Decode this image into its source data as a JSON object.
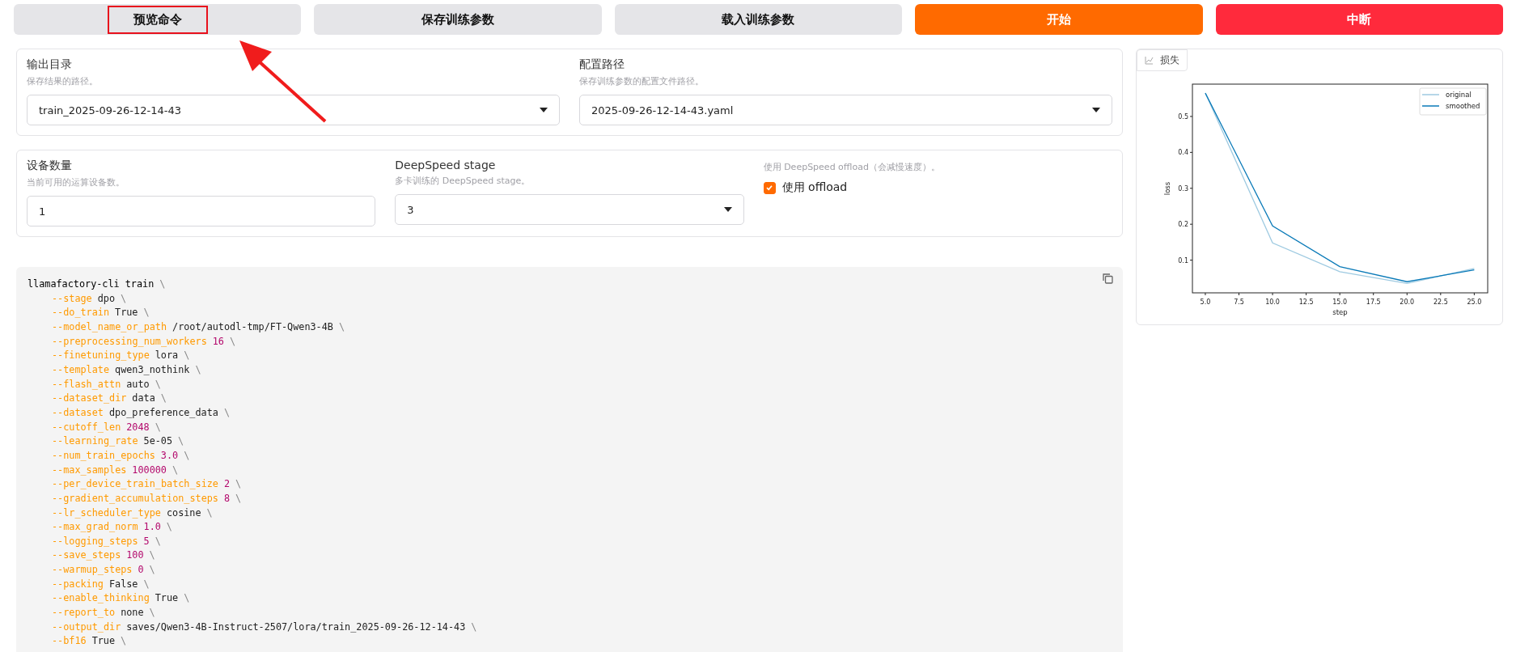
{
  "buttons": [
    {
      "label": "预览命令",
      "kind": "neutral",
      "highlighted": true
    },
    {
      "label": "保存训练参数",
      "kind": "neutral",
      "highlighted": false
    },
    {
      "label": "载入训练参数",
      "kind": "neutral",
      "highlighted": false
    },
    {
      "label": "开始",
      "kind": "primary",
      "highlighted": false
    },
    {
      "label": "中断",
      "kind": "stop",
      "highlighted": false
    }
  ],
  "paths_card": {
    "fields": [
      {
        "kind": "dropdown",
        "label": "输出目录",
        "hint": "保存结果的路径。",
        "value": "train_2025-09-26-12-14-43"
      },
      {
        "kind": "dropdown",
        "label": "配置路径",
        "hint": "保存训练参数的配置文件路径。",
        "value": "2025-09-26-12-14-43.yaml"
      }
    ]
  },
  "device_card": {
    "fields": [
      {
        "kind": "text",
        "label": "设备数量",
        "hint": "当前可用的运算设备数。",
        "value": "1"
      },
      {
        "kind": "dropdown",
        "label": "DeepSpeed stage",
        "hint": "多卡训练的 DeepSpeed stage。",
        "value": "3"
      },
      {
        "kind": "checkbox",
        "hint": "使用 DeepSpeed offload（会减慢速度）。",
        "label": "使用 offload",
        "checked": true
      }
    ]
  },
  "command": {
    "lines": [
      {
        "kind": "head",
        "value": "llamafactory-cli train",
        "end": "\\"
      },
      {
        "kind": "arg",
        "flag": "--stage",
        "value": "dpo",
        "numeric": false,
        "end": "\\"
      },
      {
        "kind": "arg",
        "flag": "--do_train",
        "value": "True",
        "numeric": false,
        "end": "\\"
      },
      {
        "kind": "arg",
        "flag": "--model_name_or_path",
        "value": "/root/autodl-tmp/FT-Qwen3-4B",
        "numeric": false,
        "end": "\\"
      },
      {
        "kind": "arg",
        "flag": "--preprocessing_num_workers",
        "value": "16",
        "numeric": true,
        "end": "\\"
      },
      {
        "kind": "arg",
        "flag": "--finetuning_type",
        "value": "lora",
        "numeric": false,
        "end": "\\"
      },
      {
        "kind": "arg",
        "flag": "--template",
        "value": "qwen3_nothink",
        "numeric": false,
        "end": "\\"
      },
      {
        "kind": "arg",
        "flag": "--flash_attn",
        "value": "auto",
        "numeric": false,
        "end": "\\"
      },
      {
        "kind": "arg",
        "flag": "--dataset_dir",
        "value": "data",
        "numeric": false,
        "end": "\\"
      },
      {
        "kind": "arg",
        "flag": "--dataset",
        "value": "dpo_preference_data",
        "numeric": false,
        "end": "\\"
      },
      {
        "kind": "arg",
        "flag": "--cutoff_len",
        "value": "2048",
        "numeric": true,
        "end": "\\"
      },
      {
        "kind": "arg",
        "flag": "--learning_rate",
        "value": "5e-05",
        "numeric": false,
        "end": "\\"
      },
      {
        "kind": "arg",
        "flag": "--num_train_epochs",
        "value": "3.0",
        "numeric": true,
        "end": "\\"
      },
      {
        "kind": "arg",
        "flag": "--max_samples",
        "value": "100000",
        "numeric": true,
        "end": "\\"
      },
      {
        "kind": "arg",
        "flag": "--per_device_train_batch_size",
        "value": "2",
        "numeric": true,
        "end": "\\"
      },
      {
        "kind": "arg",
        "flag": "--gradient_accumulation_steps",
        "value": "8",
        "numeric": true,
        "end": "\\"
      },
      {
        "kind": "arg",
        "flag": "--lr_scheduler_type",
        "value": "cosine",
        "numeric": false,
        "end": "\\"
      },
      {
        "kind": "arg",
        "flag": "--max_grad_norm",
        "value": "1.0",
        "numeric": true,
        "end": "\\"
      },
      {
        "kind": "arg",
        "flag": "--logging_steps",
        "value": "5",
        "numeric": true,
        "end": "\\"
      },
      {
        "kind": "arg",
        "flag": "--save_steps",
        "value": "100",
        "numeric": true,
        "end": "\\"
      },
      {
        "kind": "arg",
        "flag": "--warmup_steps",
        "value": "0",
        "numeric": true,
        "end": "\\"
      },
      {
        "kind": "arg",
        "flag": "--packing",
        "value": "False",
        "numeric": false,
        "end": "\\"
      },
      {
        "kind": "arg",
        "flag": "--enable_thinking",
        "value": "True",
        "numeric": false,
        "end": "\\"
      },
      {
        "kind": "arg",
        "flag": "--report_to",
        "value": "none",
        "numeric": false,
        "end": "\\"
      },
      {
        "kind": "arg",
        "flag": "--output_dir",
        "value": "saves/Qwen3-4B-Instruct-2507/lora/train_2025-09-26-12-14-43",
        "numeric": false,
        "end": "\\"
      },
      {
        "kind": "arg",
        "flag": "--bf16",
        "value": "True",
        "numeric": false,
        "end": "\\"
      }
    ]
  },
  "loss_panel": {
    "label": "损失",
    "chart_data": {
      "type": "line",
      "xlabel": "step",
      "ylabel": "loss",
      "x": [
        5,
        10,
        15,
        20,
        25
      ],
      "series": [
        {
          "name": "original",
          "color": "#9ecae1",
          "values": [
            0.565,
            0.148,
            0.068,
            0.035,
            0.077
          ]
        },
        {
          "name": "smoothed",
          "color": "#0a7ab8",
          "values": [
            0.565,
            0.195,
            0.082,
            0.04,
            0.073
          ]
        }
      ],
      "xlim": [
        4.04,
        26.0
      ],
      "ylim": [
        0.009,
        0.59
      ],
      "xticks": [
        {
          "value": 5,
          "label": "5.0"
        },
        {
          "value": 7.5,
          "label": "7.5"
        },
        {
          "value": 10,
          "label": "10.0"
        },
        {
          "value": 12.5,
          "label": "12.5"
        },
        {
          "value": 15,
          "label": "15.0"
        },
        {
          "value": 17.5,
          "label": "17.5"
        },
        {
          "value": 20,
          "label": "20.0"
        },
        {
          "value": 22.5,
          "label": "22.5"
        },
        {
          "value": 25,
          "label": "25.0"
        }
      ],
      "yticks": [
        0.1,
        0.2,
        0.3,
        0.4,
        0.5
      ],
      "legend": true
    }
  }
}
